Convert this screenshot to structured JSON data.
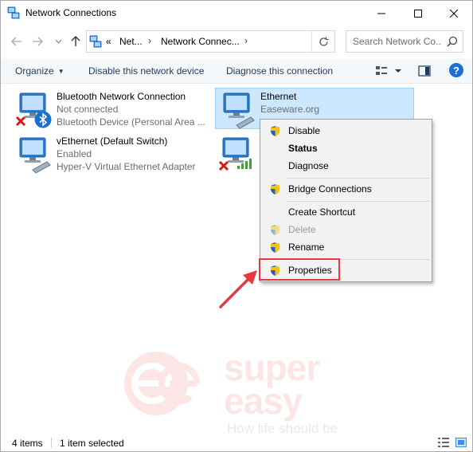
{
  "window": {
    "title": "Network Connections"
  },
  "address_bar": {
    "overflow_label": "«",
    "segments": [
      "Net...",
      "Network Connec..."
    ],
    "search_placeholder": "Search Network Co..."
  },
  "toolbar": {
    "organize": "Organize",
    "disable": "Disable this network device",
    "diagnose": "Diagnose this connection",
    "help": "?"
  },
  "connections": [
    {
      "name": "Bluetooth Network Connection",
      "status": "Not connected",
      "device": "Bluetooth Device (Personal Area ...",
      "icon": "network-adapter-icon",
      "badge": "red-x-icon",
      "selected": false
    },
    {
      "name": "Ethernet",
      "status": "Easeware.org",
      "device": "",
      "icon": "ethernet-adapter-icon",
      "badge": "",
      "selected": true
    },
    {
      "name": "vEthernet (Default Switch)",
      "status": "Enabled",
      "device": "Hyper-V Virtual Ethernet Adapter",
      "icon": "ethernet-adapter-icon",
      "badge": "",
      "selected": false
    },
    {
      "name": "",
      "status": "",
      "device": "",
      "icon": "wifi-adapter-icon",
      "badge": "red-x-icon",
      "selected": false
    }
  ],
  "context_menu": {
    "items": [
      {
        "label": "Disable",
        "shield": true,
        "bold": false,
        "disabled": false
      },
      {
        "label": "Status",
        "shield": false,
        "bold": true,
        "disabled": false
      },
      {
        "label": "Diagnose",
        "shield": false,
        "bold": false,
        "disabled": false
      },
      {
        "label": "Bridge Connections",
        "shield": true,
        "bold": false,
        "disabled": false
      },
      {
        "label": "Create Shortcut",
        "shield": false,
        "bold": false,
        "disabled": false
      },
      {
        "label": "Delete",
        "shield": true,
        "bold": false,
        "disabled": true
      },
      {
        "label": "Rename",
        "shield": true,
        "bold": false,
        "disabled": false
      },
      {
        "label": "Properties",
        "shield": true,
        "bold": false,
        "disabled": false
      }
    ],
    "highlighted": "Properties"
  },
  "watermark": {
    "line1": "super",
    "line2": "easy",
    "tagline": "How life should be"
  },
  "statusbar": {
    "items_count": "4 items",
    "selected": "1 item selected"
  },
  "colors": {
    "accent_highlight": "#e5393e",
    "selection_bg": "#cce8ff",
    "toolbar_text": "#1e395b",
    "help_button": "#1a6fd0"
  }
}
